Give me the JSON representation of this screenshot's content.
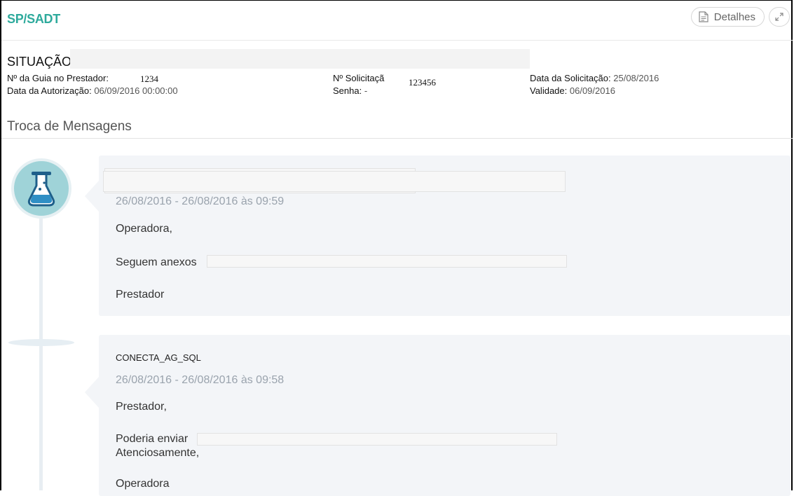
{
  "panel": {
    "title": "SP/SADT",
    "details_button": "Detalhes",
    "details_icon": "document-icon",
    "expand_icon": "expand-icon"
  },
  "header": {
    "situacao_label": "SITUAÇÃO:"
  },
  "info": {
    "guia_label": "Nº da Guia no Prestador:",
    "guia_value": "1234",
    "solicitacao_label": "Nº Solicitaçã",
    "solicitacao_value": "123456",
    "data_solicitacao_label": "Data da Solicitação:",
    "data_solicitacao_value": "25/08/2016",
    "data_autorizacao_label": "Data da Autorização:",
    "data_autorizacao_value": "06/09/2016 00:00:00",
    "senha_label": "Senha:",
    "senha_value": "-",
    "validade_label": "Validade:",
    "validade_value": "06/09/2016"
  },
  "section": {
    "title": "Troca de Mensagens"
  },
  "messages": [
    {
      "author": "",
      "date": "26/08/2016 - 26/08/2016 às 09:59",
      "greeting": "Operadora,",
      "body": "Seguem anexos",
      "signature": "Prestador",
      "avatar_icon": "flask-icon"
    },
    {
      "author": "CONECTA_AG_SQL",
      "date": "26/08/2016 - 26/08/2016 às 09:58",
      "greeting": "Prestador,",
      "body": "Poderia enviar",
      "closing": "Atenciosamente,",
      "signature": "Operadora"
    }
  ],
  "colors": {
    "accent": "#2eaa9c",
    "bubble": "#f3f5f8",
    "avatar": "#9fd3d8"
  }
}
